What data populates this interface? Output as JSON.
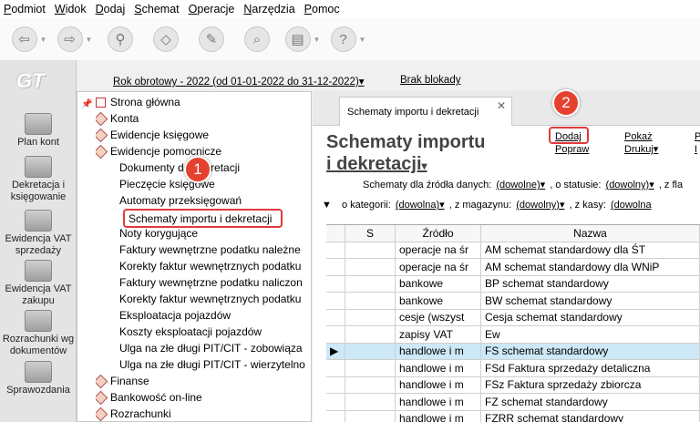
{
  "menu": [
    "Podmiot",
    "Widok",
    "Dodaj",
    "Schemat",
    "Operacje",
    "Narzędzia",
    "Pomoc"
  ],
  "toolbar_icons": [
    "arrow-left-icon",
    "arrow-right-icon",
    "stamp-icon",
    "eraser-icon",
    "tools-icon",
    "search-icon",
    "printer-icon",
    "help-icon"
  ],
  "logo": "GT",
  "left_nav": [
    {
      "label": "Plan kont",
      "icon": "accounts-icon"
    },
    {
      "label": "Dekretacja i księgowanie",
      "icon": "pencil-icon"
    },
    {
      "label": "Ewidencja VAT sprzedaży",
      "icon": "coins-icon"
    },
    {
      "label": "Ewidencja VAT zakupu",
      "icon": "coins-icon"
    },
    {
      "label": "Rozrachunki wg dokumentów",
      "icon": "check-icon"
    },
    {
      "label": "Sprawozdania",
      "icon": "chart-icon"
    }
  ],
  "year_bar": {
    "year": "Rok obrotowy - 2022  (od 01-01-2022 do 31-12-2022)▾",
    "lock": "Brak blokady"
  },
  "tree": {
    "top_nodes": [
      "Strona główna",
      "Konta",
      "Ewidencje księgowe",
      "Ewidencje pomocnicze"
    ],
    "children": [
      "Dokumenty do dekretacji",
      "Pieczęcie księgowe",
      "Automaty przeksięgowań",
      "Schematy importu i dekretacji",
      "Noty korygujące",
      "Faktury wewnętrzne podatku należne",
      "Korekty faktur wewnętrznych podatku",
      "Faktury wewnętrzne podatku naliczon",
      "Korekty faktur wewnętrznych podatku",
      "Eksploatacja pojazdów",
      "Koszty eksploatacji pojazdów",
      "Ulga na złe długi PIT/CIT - zobowiąza",
      "Ulga na złe długi PIT/CIT - wierzytelno"
    ],
    "bottom_nodes": [
      "Finanse",
      "Bankowość on-line",
      "Rozrachunki"
    ]
  },
  "badges": {
    "one": "1",
    "two": "2"
  },
  "tab": {
    "label": "Schematy importu i dekretacji",
    "close": "✕"
  },
  "title": {
    "line1": "Schematy importu",
    "line2": "i dekretacji"
  },
  "actions": {
    "dodaj": "Dodaj",
    "popraw": "Popraw",
    "pokaz": "Pokaż",
    "drukuj": "Drukuj▾",
    "p_clip": "P",
    "i_clip": "I"
  },
  "filters": {
    "row1_prefix": "Schematy dla źródła danych:",
    "row1_val1": "(dowolne)▾",
    "row1_mid": ", o statusie:",
    "row1_val2": "(dowolny)▾",
    "row1_tail": ", z fla",
    "row2_prefix": "o kategorii:",
    "row2_val1": "(dowolna)▾",
    "row2_mid": ", z magazynu:",
    "row2_val2": "(dowolny)▾",
    "row2_mid2": ", z kasy:",
    "row2_val3": "(dowolna"
  },
  "grid": {
    "headers": [
      "",
      "S",
      "Źródło",
      "Nazwa"
    ],
    "rows": [
      [
        "",
        "",
        "operacje na śr",
        "AM schemat standardowy dla ŚT"
      ],
      [
        "",
        "",
        "operacje na śr",
        "AM schemat standardowy dla WNiP"
      ],
      [
        "",
        "",
        "bankowe",
        "BP schemat standardowy"
      ],
      [
        "",
        "",
        "bankowe",
        "BW schemat standardowy"
      ],
      [
        "",
        "",
        "cesje (wszyst",
        "Cesja schemat standardowy"
      ],
      [
        "",
        "",
        "zapisy VAT",
        "Ew"
      ],
      [
        "▶",
        "",
        "handlowe i m",
        "FS schemat standardowy"
      ],
      [
        "",
        "",
        "handlowe i m",
        "FSd Faktura sprzedaży detaliczna"
      ],
      [
        "",
        "",
        "handlowe i m",
        "FSz Faktura sprzedaży zbiorcza"
      ],
      [
        "",
        "",
        "handlowe i m",
        "FZ schemat standardowy"
      ],
      [
        "",
        "",
        "handlowe i m",
        "FZRR schemat standardowy"
      ]
    ]
  }
}
